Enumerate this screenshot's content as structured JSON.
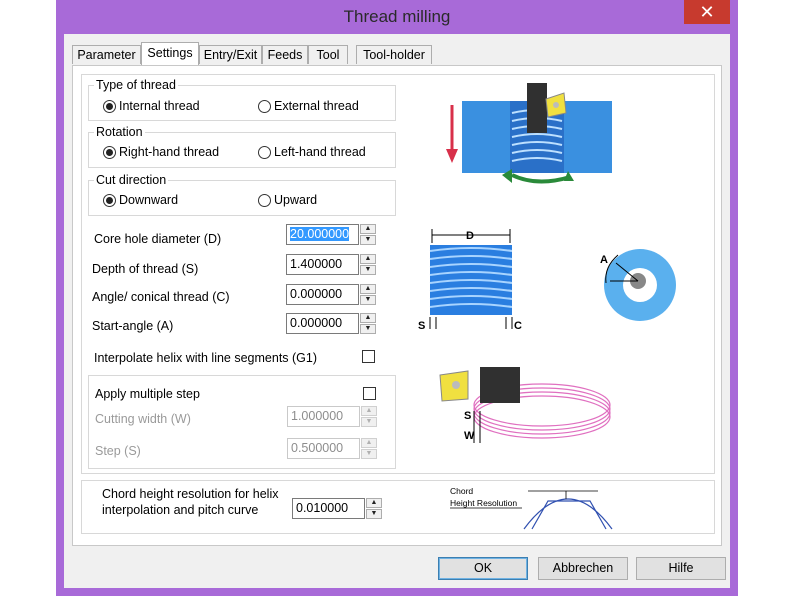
{
  "window": {
    "title": "Thread milling",
    "close_label": "✕"
  },
  "tabs": [
    {
      "label": "Parameter"
    },
    {
      "label": "Settings"
    },
    {
      "label": "Entry/Exit"
    },
    {
      "label": "Feeds"
    },
    {
      "label": "Tool"
    },
    {
      "label": "Tool-holder"
    }
  ],
  "type_of_thread": {
    "title": "Type of thread",
    "options": [
      "Internal thread",
      "External thread"
    ],
    "selected": "Internal thread"
  },
  "rotation": {
    "title": "Rotation",
    "options": [
      "Right-hand thread",
      "Left-hand thread"
    ],
    "selected": "Right-hand thread"
  },
  "cut_direction": {
    "title": "Cut direction",
    "options": [
      "Downward",
      "Upward"
    ],
    "selected": "Downward"
  },
  "params": {
    "core_hole": {
      "label": "Core hole diameter (D)",
      "value": "20.000000"
    },
    "depth": {
      "label": "Depth of thread (S)",
      "value": "1.400000"
    },
    "angle": {
      "label": "Angle/ conical thread (C)",
      "value": "0.000000"
    },
    "start_angle": {
      "label": "Start-angle (A)",
      "value": "0.000000"
    },
    "interpolate": {
      "label": "Interpolate helix with line segments (G1)",
      "checked": false
    }
  },
  "multi_step": {
    "label": "Apply multiple step",
    "checked": false,
    "cutting_width": {
      "label": "Cutting width (W)",
      "value": "1.000000"
    },
    "step": {
      "label": "Step (S)",
      "value": "0.500000"
    }
  },
  "chord": {
    "label_line1": "Chord height resolution for helix",
    "label_line2": "interpolation and pitch curve",
    "value": "0.010000",
    "diagram_label1": "Chord",
    "diagram_label2": "Height Resolution"
  },
  "diagram_labels": {
    "D": "D",
    "S": "S",
    "C": "C",
    "A": "A",
    "W": "W"
  },
  "buttons": {
    "ok": "OK",
    "cancel": "Abbrechen",
    "help": "Hilfe"
  },
  "colors": {
    "frame": "#a86ad8",
    "close": "#c73a2e",
    "blue": "#3a7fe0",
    "pink": "#e070c0",
    "green": "#2a8a3a"
  }
}
